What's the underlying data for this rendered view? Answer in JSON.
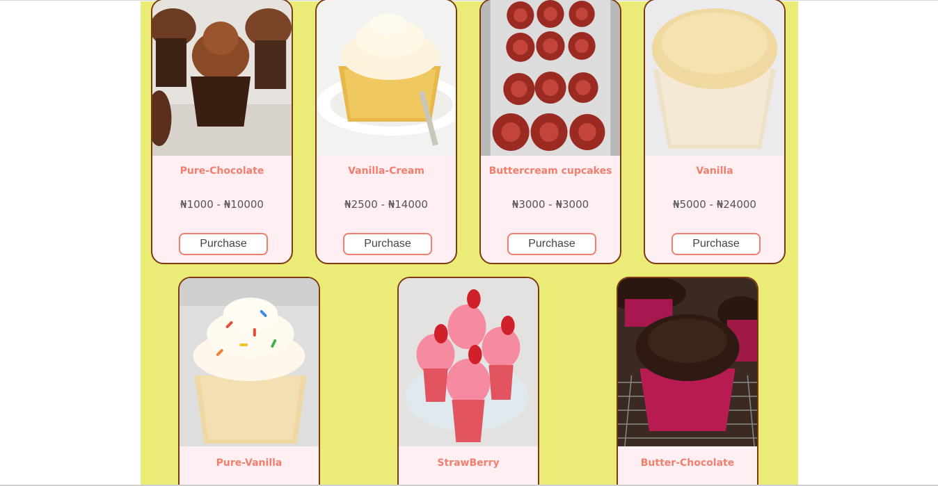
{
  "products_row1": [
    {
      "name": "Pure-Chocolate",
      "price": "₦1000 - ₦10000",
      "button": "Purchase",
      "image": "chocolate-cupcake-photo"
    },
    {
      "name": "Vanilla-Cream",
      "price": "₦2500 - ₦14000",
      "button": "Purchase",
      "image": "vanilla-cream-cupcake-photo"
    },
    {
      "name": "Buttercream cupcakes",
      "price": "₦3000 - ₦3000",
      "button": "Purchase",
      "image": "buttercream-cupcakes-box-photo"
    },
    {
      "name": "Vanilla",
      "price": "₦5000 - ₦24000",
      "button": "Purchase",
      "image": "plain-vanilla-muffin-photo"
    }
  ],
  "products_row2": [
    {
      "name": "Pure-Vanilla",
      "image": "sprinkles-vanilla-cupcake-photo"
    },
    {
      "name": "StrawBerry",
      "image": "strawberry-cupcakes-photo"
    },
    {
      "name": "Butter-Chocolate",
      "image": "chocolate-frosting-cupcake-photo"
    }
  ],
  "colors": {
    "panel_bg": "#ebeb77",
    "card_bg": "#ffeef2",
    "card_border": "#7b3a12",
    "accent": "#f07f6d"
  }
}
